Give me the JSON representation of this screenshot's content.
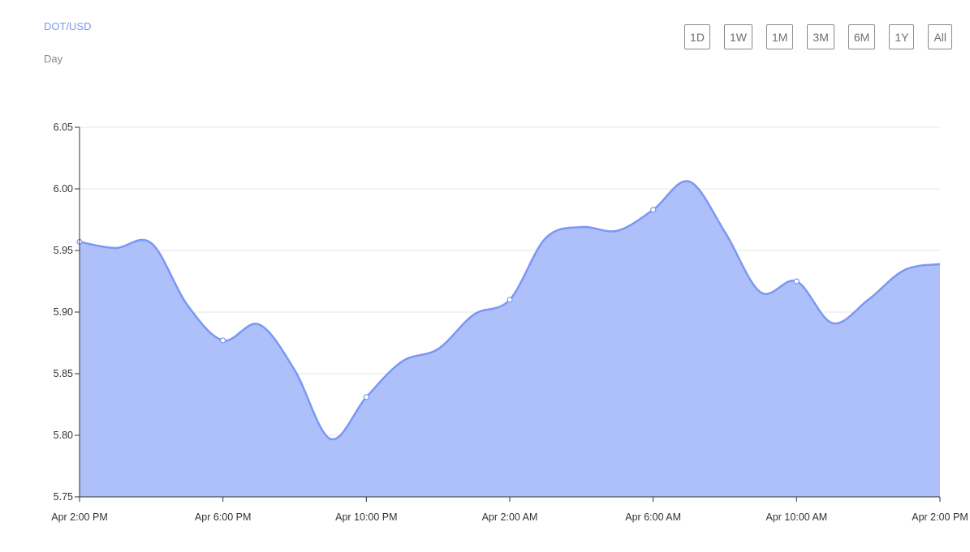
{
  "header": {
    "pair": "DOT/USD",
    "period": "Day"
  },
  "range_buttons": [
    "1D",
    "1W",
    "1M",
    "3M",
    "6M",
    "1Y",
    "All"
  ],
  "colors": {
    "line": "#7b97f4",
    "fill": "#aec0fa",
    "grid": "#e6e6e6",
    "axis": "#333333"
  },
  "chart_data": {
    "type": "area",
    "title": "",
    "xlabel": "",
    "ylabel": "",
    "ylim": [
      5.75,
      6.05
    ],
    "y_ticks": [
      "5.75",
      "5.80",
      "5.85",
      "5.90",
      "5.95",
      "6.00",
      "6.05"
    ],
    "x_ticks": [
      "Apr 2:00 PM",
      "Apr 6:00 PM",
      "Apr 10:00 PM",
      "Apr 2:00 AM",
      "Apr 6:00 AM",
      "Apr 10:00 AM",
      "Apr 2:00 PM"
    ],
    "grid": true,
    "x_hours": [
      0,
      1,
      2,
      3,
      4,
      5,
      6,
      7,
      8,
      9,
      10,
      11,
      12,
      13,
      14,
      15,
      16,
      17,
      18,
      19,
      20,
      21,
      22,
      23,
      24
    ],
    "values": [
      5.957,
      5.952,
      5.956,
      5.906,
      5.877,
      5.89,
      5.853,
      5.797,
      5.831,
      5.86,
      5.87,
      5.898,
      5.91,
      5.96,
      5.969,
      5.966,
      5.983,
      6.006,
      5.965,
      5.916,
      5.925,
      5.891,
      5.91,
      5.934,
      5.939
    ],
    "markers_at_hours": [
      0,
      4,
      8,
      12,
      16,
      20
    ]
  }
}
